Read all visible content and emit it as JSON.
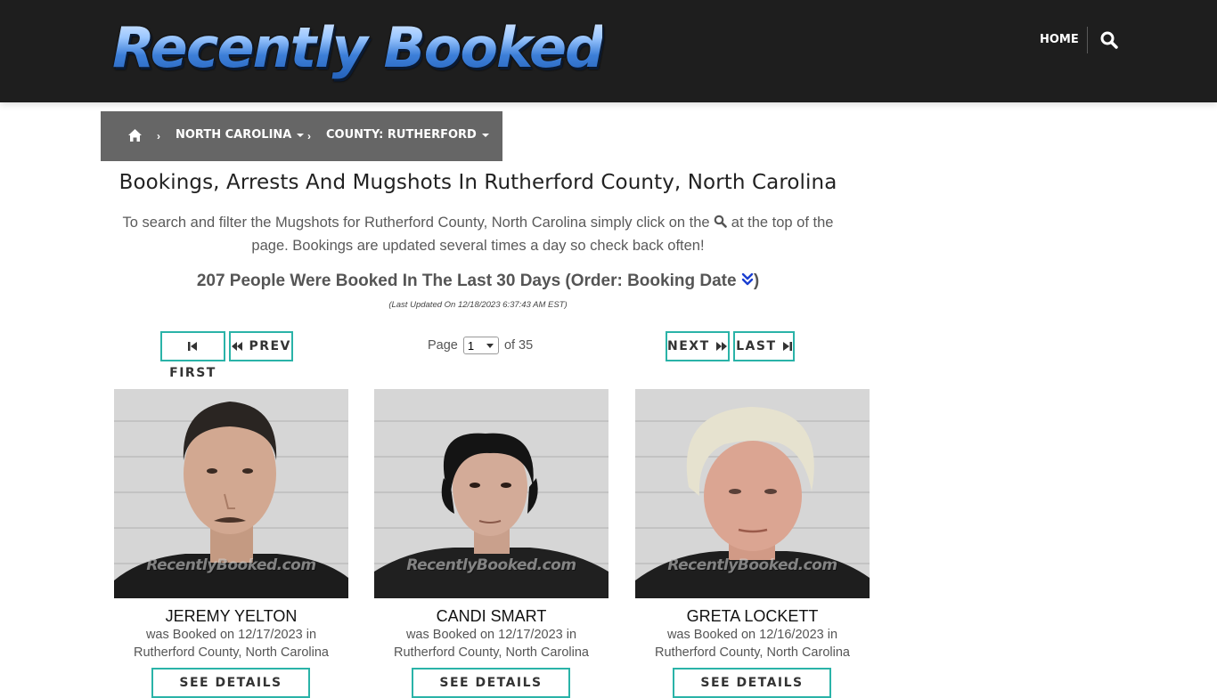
{
  "header": {
    "logo_text": "Recently Booked",
    "nav_home": "HOME"
  },
  "breadcrumb": {
    "state": "NORTH CAROLINA",
    "county": "COUNTY: RUTHERFORD"
  },
  "page_title": "Bookings, Arrests And Mugshots In Rutherford County, North Carolina",
  "intro": {
    "before_icon": "To search and filter the Mugshots for Rutherford County, North Carolina simply click on the",
    "after_icon": "at the top of the page. Bookings are updated several times a day so check back often!"
  },
  "count_line": {
    "text": "207 People Were Booked In The Last 30 Days (Order: Booking Date",
    "close": ")"
  },
  "last_updated": "(Last Updated On 12/18/2023 6:37:43 AM EST)",
  "pagination": {
    "first": "FIRST",
    "prev": "PREV",
    "next": "NEXT",
    "last": "LAST",
    "page_label": "Page",
    "page_value": "1",
    "of_label": "of 35"
  },
  "watermark": "RecentlyBooked.com",
  "bookings": [
    {
      "name": "JEREMY YELTON",
      "booked_line": "was Booked on 12/17/2023 in",
      "location": "Rutherford County, North Carolina",
      "details": "SEE DETAILS"
    },
    {
      "name": "CANDI SMART",
      "booked_line": "was Booked on 12/17/2023 in",
      "location": "Rutherford County, North Carolina",
      "details": "SEE DETAILS"
    },
    {
      "name": "GRETA LOCKETT",
      "booked_line": "was Booked on 12/16/2023 in",
      "location": "Rutherford County, North Carolina",
      "details": "SEE DETAILS"
    }
  ],
  "colors": {
    "header_bg": "#1e1e1e",
    "breadcrumb_bg": "#666666",
    "accent_border": "#2ab3a8",
    "sort_icon": "#1a3fd1"
  }
}
